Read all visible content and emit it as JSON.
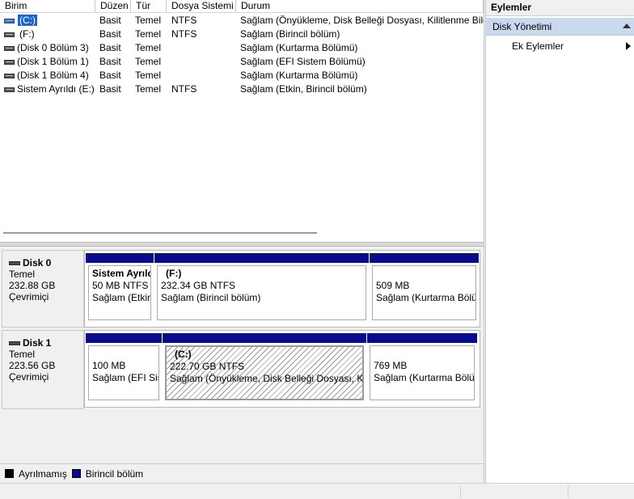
{
  "columns": [
    "Birim",
    "Düzen",
    "Tür",
    "Dosya Sistemi",
    "Durum"
  ],
  "volumes": [
    {
      "name": "(C:)",
      "layout": "Basit",
      "type": "Temel",
      "fs": "NTFS",
      "status": "Sağlam (Önyükleme, Disk Belleği Dosyası, Kilitlenme Bilg",
      "icon": "system-drive-icon",
      "selected": true
    },
    {
      "name": "(F:)",
      "layout": "Basit",
      "type": "Temel",
      "fs": "NTFS",
      "status": "Sağlam (Birincil bölüm)",
      "icon": "drive-icon"
    },
    {
      "name": "(Disk 0 Bölüm 3)",
      "layout": "Basit",
      "type": "Temel",
      "fs": "",
      "status": "Sağlam (Kurtarma Bölümü)",
      "icon": "drive-icon"
    },
    {
      "name": "(Disk 1 Bölüm 1)",
      "layout": "Basit",
      "type": "Temel",
      "fs": "",
      "status": "Sağlam (EFI Sistem Bölümü)",
      "icon": "drive-icon"
    },
    {
      "name": "(Disk 1 Bölüm 4)",
      "layout": "Basit",
      "type": "Temel",
      "fs": "",
      "status": "Sağlam (Kurtarma Bölümü)",
      "icon": "drive-icon"
    },
    {
      "name": "Sistem Ayrıldı (E:)",
      "layout": "Basit",
      "type": "Temel",
      "fs": "NTFS",
      "status": "Sağlam (Etkin, Birincil bölüm)",
      "icon": "drive-icon"
    }
  ],
  "disks": [
    {
      "title": "Disk 0",
      "kind": "Temel",
      "size": "232.88 GB",
      "state": "Çevrimiçi",
      "partitions": [
        {
          "line1": "Sistem Ayrıldı",
          "line2": "50 MB NTFS",
          "line3": "Sağlam (Etkin, Birincil bölüm)"
        },
        {
          "line1": "(F:)",
          "line2": "232.34 GB NTFS",
          "line3": "Sağlam (Birincil bölüm)"
        },
        {
          "line1": "",
          "line2": "509 MB",
          "line3": "Sağlam (Kurtarma Bölümü)"
        }
      ]
    },
    {
      "title": "Disk 1",
      "kind": "Temel",
      "size": "223.56 GB",
      "state": "Çevrimiçi",
      "partitions": [
        {
          "line1": "",
          "line2": "100 MB",
          "line3": "Sağlam (EFI Sistem Bölümü)"
        },
        {
          "line1": "(C:)",
          "line2": "222.70 GB NTFS",
          "line3": "Sağlam (Önyükleme, Disk Belleği Dosyası, Kilitlenme Bilgi Dökümü, Birincil bölüm)"
        },
        {
          "line1": "",
          "line2": "769 MB",
          "line3": "Sağlam (Kurtarma Bölümü)"
        }
      ]
    }
  ],
  "legend": [
    {
      "label": "Ayrılmamış",
      "color": "#000000"
    },
    {
      "label": "Birincil bölüm",
      "color": "#0a0a8c"
    }
  ],
  "actions": {
    "title": "Eylemler",
    "group": "Disk Yönetimi",
    "more": "Ek Eylemler"
  }
}
